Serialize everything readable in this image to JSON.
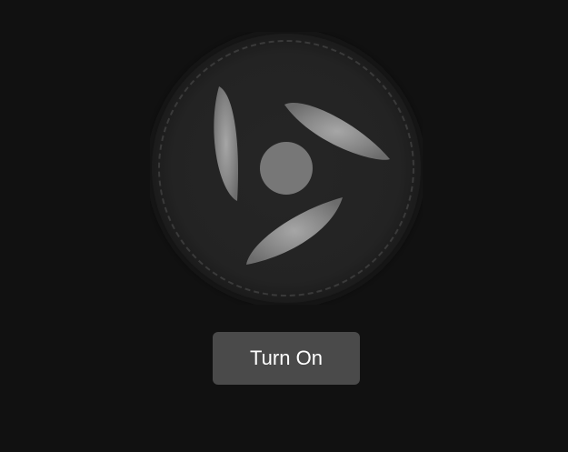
{
  "fan": {
    "state": "off",
    "blade_count": 3,
    "icon": "fan-icon"
  },
  "controls": {
    "toggle_label": "Turn On"
  },
  "colors": {
    "background": "#111111",
    "fan_body": "#252525",
    "blade": "#8a8a8a",
    "hub": "#777777",
    "button_bg": "#4a4a4a",
    "button_text": "#ffffff"
  }
}
